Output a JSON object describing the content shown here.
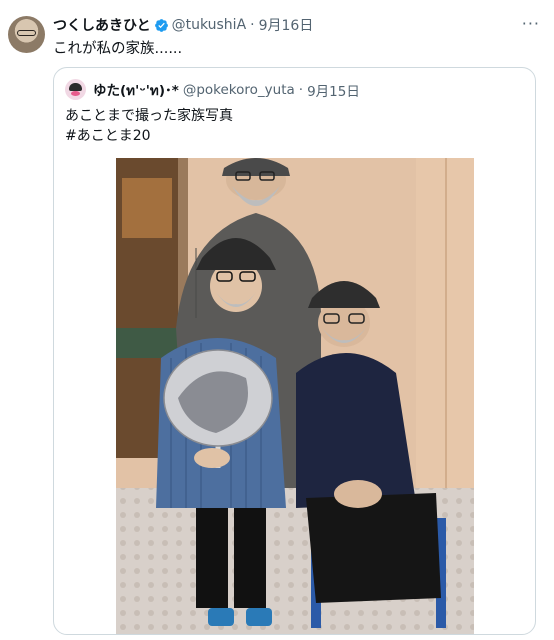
{
  "tweet": {
    "display_name": "つくしあきひと",
    "handle": "@tukushiA",
    "separator": "·",
    "date": "9月16日",
    "text": "これが私の家族......",
    "more_label": "···",
    "verified": true
  },
  "quoted_tweet": {
    "display_name": "ゆた(ท'ᵕ'ท)･*",
    "handle": "@pokekoro_yuta",
    "separator": "·",
    "date": "9月15日",
    "text_lines": [
      "あことまで撮った家族写真",
      "#あことま20"
    ]
  },
  "colors": {
    "verified_blue": "#1d9bf0",
    "secondary_text": "#536471",
    "border": "#cfd9de"
  },
  "icons": {
    "verified": "verified-badge-icon",
    "more": "more-dots-icon"
  }
}
